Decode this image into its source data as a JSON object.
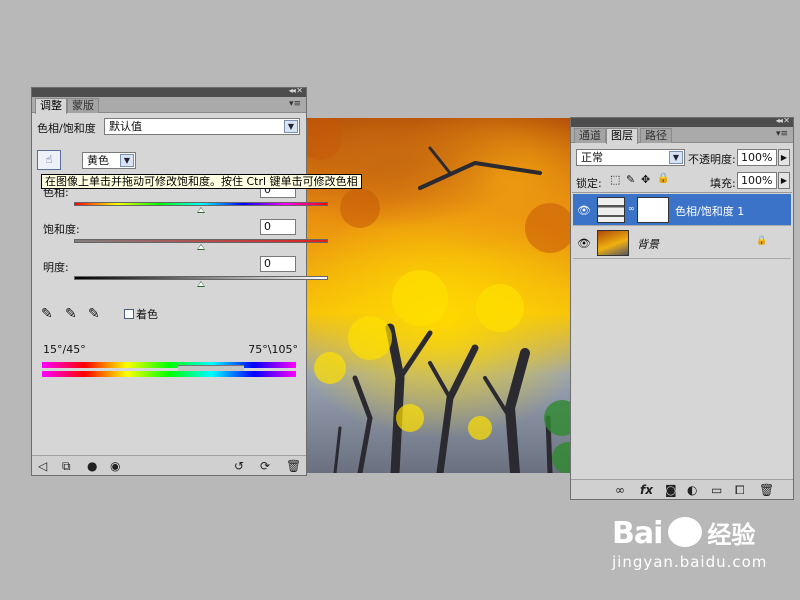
{
  "adjust_panel": {
    "tabs": [
      "调整",
      "蒙版"
    ],
    "title": "色相/饱和度",
    "preset_value": "默认值",
    "channel_value": "黄色",
    "tooltip": "在图像上单击并拖动可修改饱和度。按住 Ctrl 键单击可修改色相",
    "hue_label": "色相:",
    "hue_value": "0",
    "saturation_label": "饱和度:",
    "saturation_value": "0",
    "lightness_label": "明度:",
    "lightness_value": "0",
    "colorize_label": "着色",
    "range_left": "15°/45°",
    "range_right": "75°\\105°",
    "hue_level": 0.5,
    "saturation_level": 0.5,
    "lightness_level": 0.5
  },
  "layers_panel": {
    "tabs": [
      "通道",
      "图层",
      "路径"
    ],
    "blend_mode": "正常",
    "opacity_label": "不透明度:",
    "opacity_value": "100%",
    "lock_label": "锁定:",
    "fill_label": "填充:",
    "fill_value": "100%",
    "layers": [
      {
        "name": "色相/饱和度 1",
        "selected": true
      },
      {
        "name": "背景",
        "selected": false
      }
    ]
  },
  "watermark": {
    "brand": "Bai",
    "brand2": "经验",
    "url": "jingyan.baidu.com"
  },
  "colors": {
    "panel_bg": "#d6d6d6",
    "selection": "#3b73c8",
    "workspace": "#b8b8b8"
  }
}
